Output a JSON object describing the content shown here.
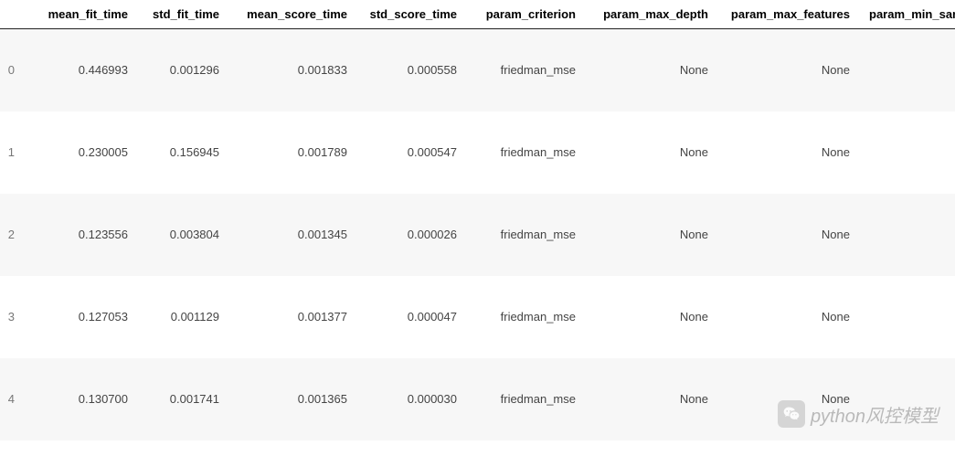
{
  "table": {
    "columns": [
      "mean_fit_time",
      "std_fit_time",
      "mean_score_time",
      "std_score_time",
      "param_criterion",
      "param_max_depth",
      "param_max_features",
      "param_min_san"
    ],
    "index": [
      "0",
      "1",
      "2",
      "3",
      "4"
    ],
    "rows": [
      {
        "mean_fit_time": "0.446993",
        "std_fit_time": "0.001296",
        "mean_score_time": "0.001833",
        "std_score_time": "0.000558",
        "param_criterion": "friedman_mse",
        "param_max_depth": "None",
        "param_max_features": "None",
        "param_min_san": ""
      },
      {
        "mean_fit_time": "0.230005",
        "std_fit_time": "0.156945",
        "mean_score_time": "0.001789",
        "std_score_time": "0.000547",
        "param_criterion": "friedman_mse",
        "param_max_depth": "None",
        "param_max_features": "None",
        "param_min_san": ""
      },
      {
        "mean_fit_time": "0.123556",
        "std_fit_time": "0.003804",
        "mean_score_time": "0.001345",
        "std_score_time": "0.000026",
        "param_criterion": "friedman_mse",
        "param_max_depth": "None",
        "param_max_features": "None",
        "param_min_san": ""
      },
      {
        "mean_fit_time": "0.127053",
        "std_fit_time": "0.001129",
        "mean_score_time": "0.001377",
        "std_score_time": "0.000047",
        "param_criterion": "friedman_mse",
        "param_max_depth": "None",
        "param_max_features": "None",
        "param_min_san": ""
      },
      {
        "mean_fit_time": "0.130700",
        "std_fit_time": "0.001741",
        "mean_score_time": "0.001365",
        "std_score_time": "0.000030",
        "param_criterion": "friedman_mse",
        "param_max_depth": "None",
        "param_max_features": "None",
        "param_min_san": ""
      }
    ]
  },
  "watermark": {
    "text": "python风控模型"
  }
}
